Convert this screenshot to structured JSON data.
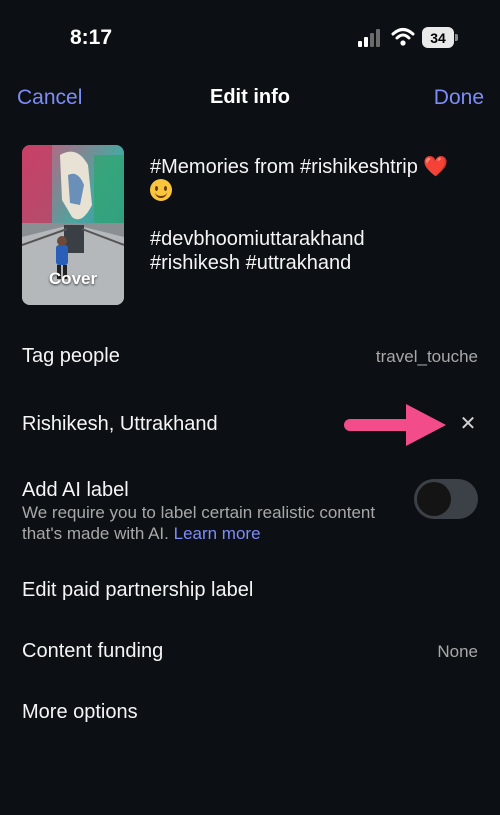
{
  "status_bar": {
    "time": "8:17",
    "battery": "34"
  },
  "header": {
    "cancel": "Cancel",
    "title": "Edit info",
    "done": "Done"
  },
  "post": {
    "cover_label": "Cover",
    "caption_line1": "#Memories from #rishikeshtrip",
    "caption_heart": "❤️",
    "caption_line3": "#devbhoomiuttarakhand",
    "caption_line4": "#rishikesh #uttrakhand"
  },
  "tag_people": {
    "label": "Tag people",
    "value": "travel_touche"
  },
  "location": {
    "label": "Rishikesh, Uttrakhand"
  },
  "ai_label": {
    "label": "Add AI label",
    "description": "We require you to label certain realistic content that's made with AI.",
    "learn_more": "Learn more",
    "enabled": false
  },
  "paid_partnership": {
    "label": "Edit paid partnership label"
  },
  "content_funding": {
    "label": "Content funding",
    "value": "None"
  },
  "more_options": {
    "label": "More options"
  },
  "colors": {
    "accent": "#7d8cf7",
    "annotation_arrow": "#f24d8a",
    "background": "#0c1014"
  }
}
